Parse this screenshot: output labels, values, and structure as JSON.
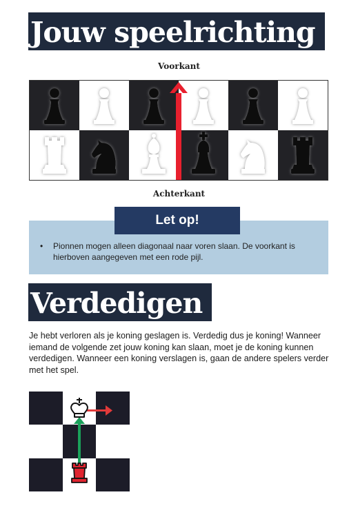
{
  "section1": {
    "title": "Jouw speelrichting",
    "front_label": "Voorkant",
    "back_label": "Achterkant",
    "board": {
      "top_row": [
        "black-pawn",
        "white-pawn",
        "black-pawn",
        "white-pawn",
        "black-pawn",
        "white-pawn"
      ],
      "bottom_row": [
        "white-rook",
        "black-knight",
        "white-bishop",
        "black-king",
        "white-knight",
        "black-rook"
      ],
      "arrow_color": "#e8202e"
    }
  },
  "notice": {
    "title": "Let op!",
    "bullet": "Pionnen mogen alleen diagonaal naar voren slaan. De voor­kant is hierboven aangegeven met een rode pijl."
  },
  "section2": {
    "title": "Verdedigen",
    "body": "Je hebt verloren als je koning geslagen is. Verdedig dus je koning! Wanneer iemand de volgende zet jouw koning kan slaan, moet je de koning kunnen verdedigen. Wanneer een koning verslagen is, gaan de andere spelers verder met het spel."
  },
  "colors": {
    "heading_bg": "#1f2a3d",
    "notice_bg": "#b3cde0",
    "notice_title_bg": "#243a63",
    "dark_square": "#1c1c28",
    "attack_arrow": "#e23a3a",
    "defend_arrow": "#1aa05a",
    "rook_red": "#e0242f"
  }
}
